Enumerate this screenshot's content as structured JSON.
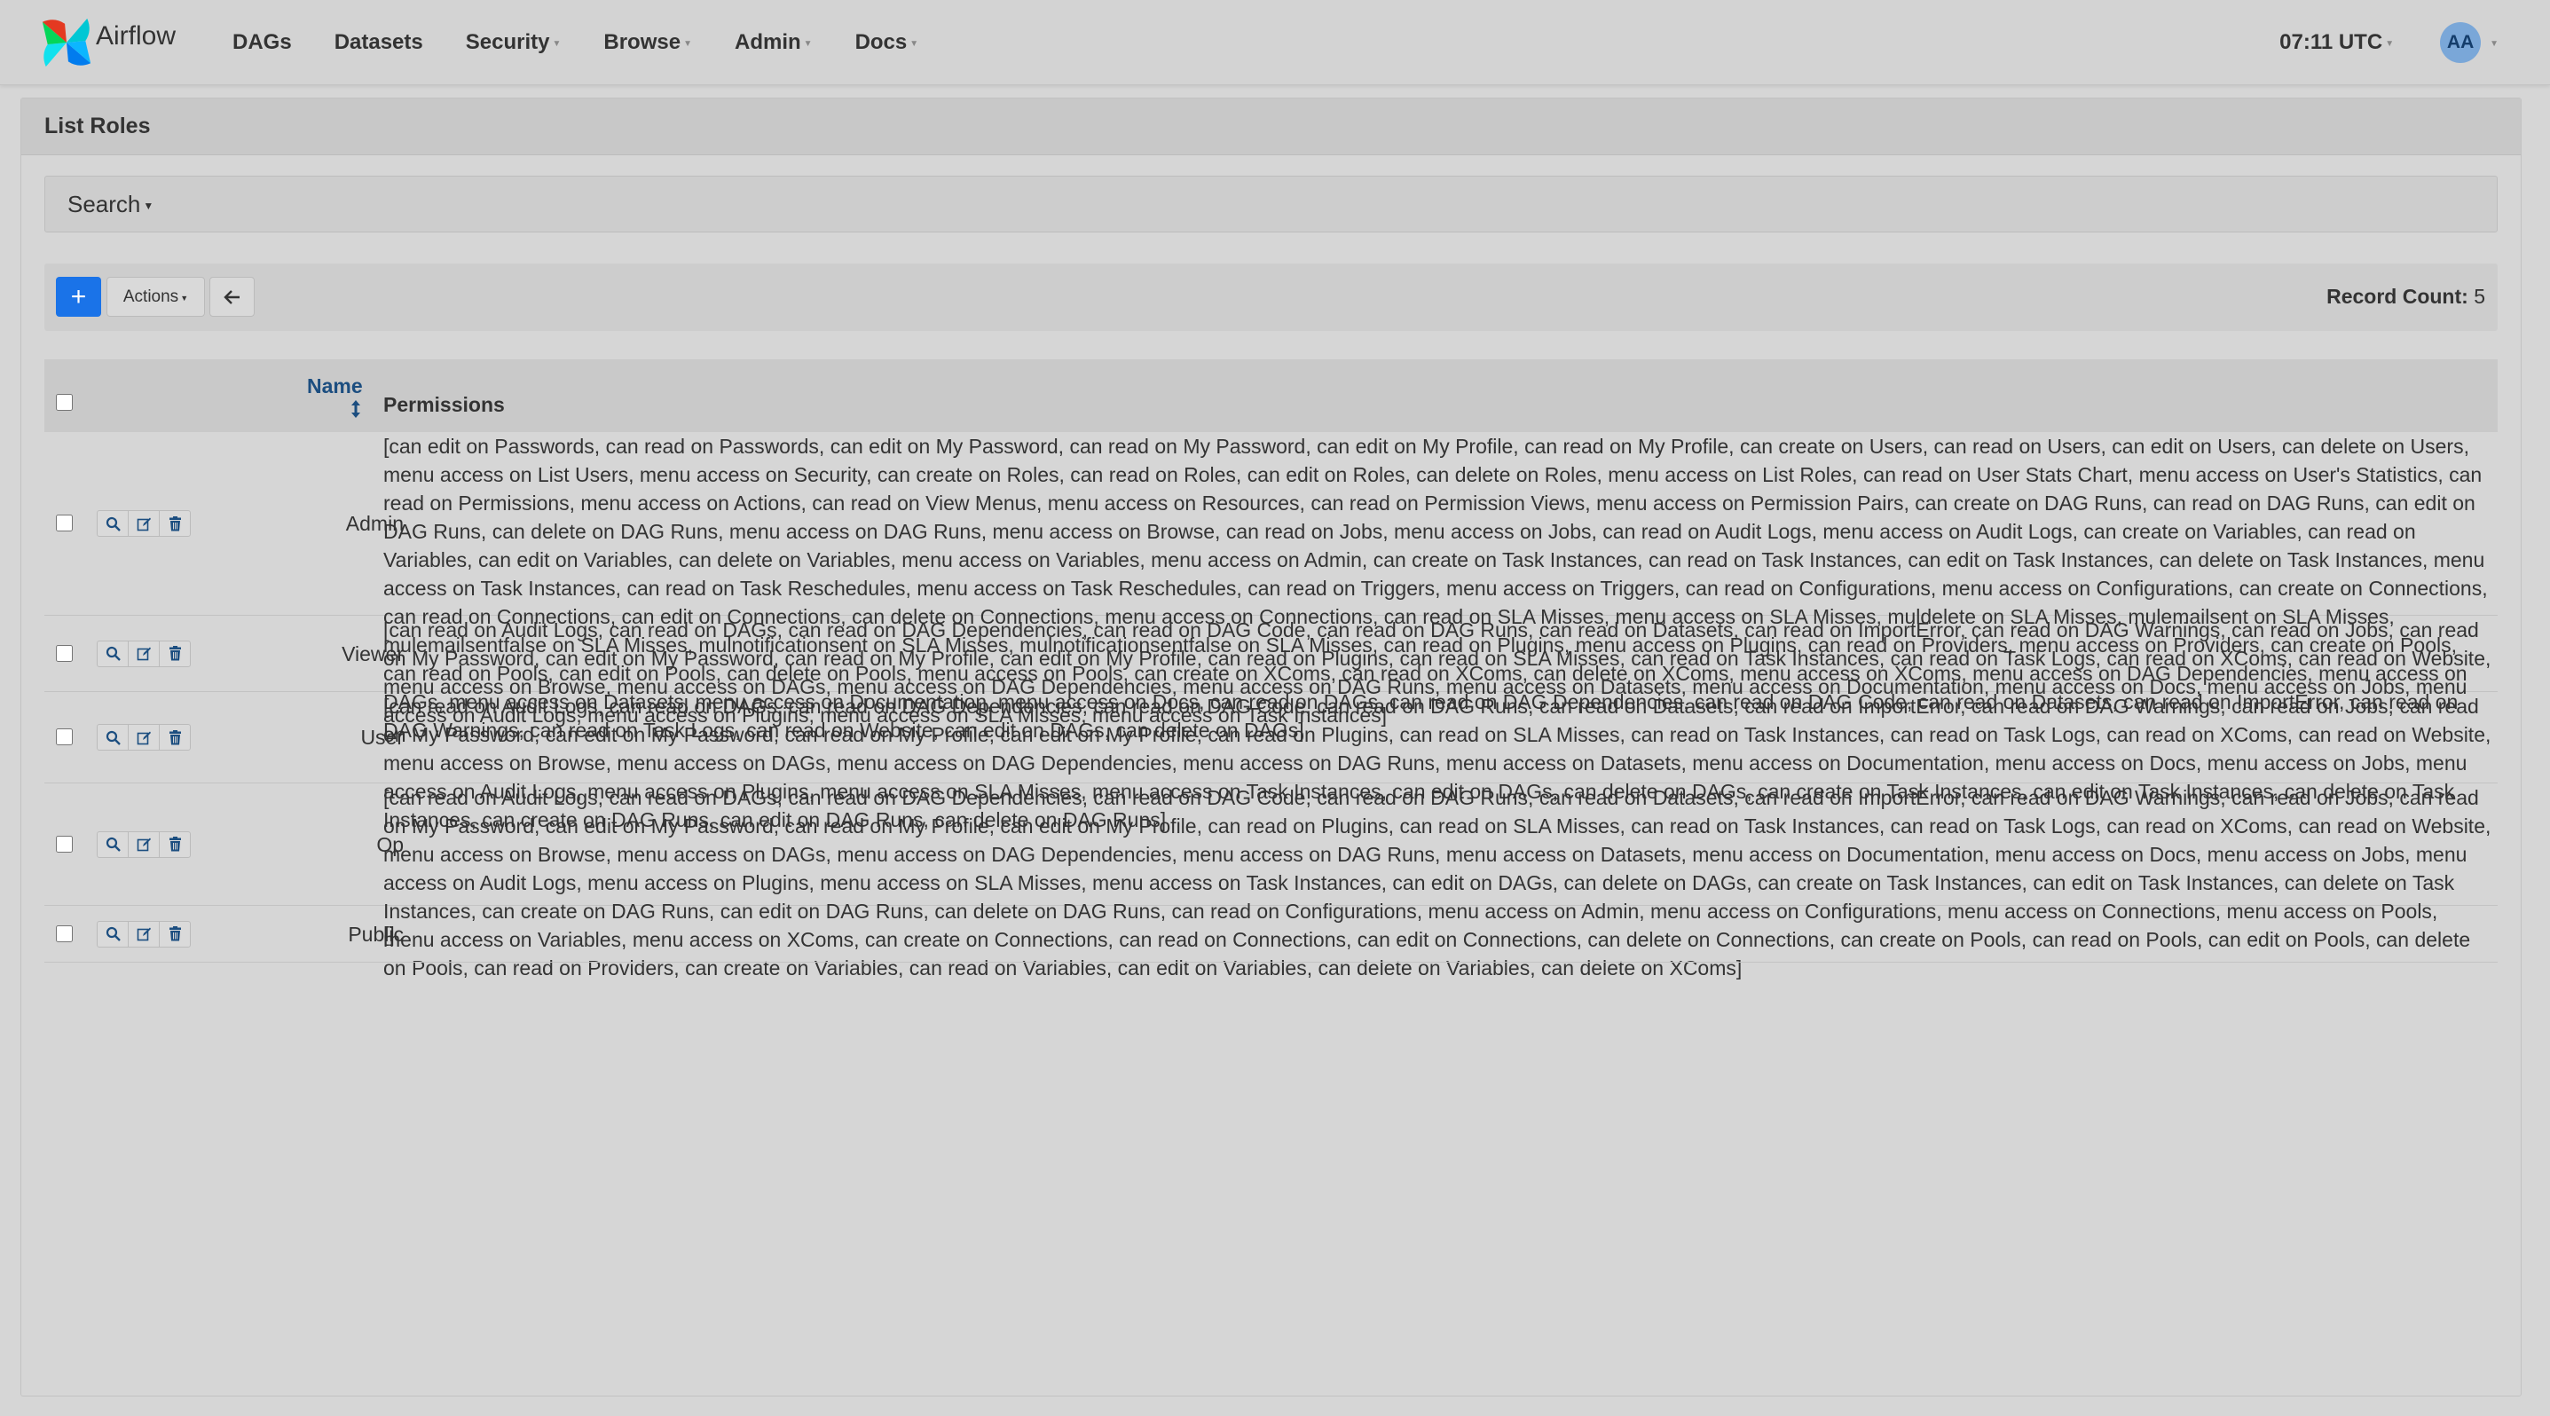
{
  "navbar": {
    "brand": "Airflow",
    "menu": [
      {
        "label": "DAGs",
        "dropdown": false
      },
      {
        "label": "Datasets",
        "dropdown": false
      },
      {
        "label": "Security",
        "dropdown": true
      },
      {
        "label": "Browse",
        "dropdown": true
      },
      {
        "label": "Admin",
        "dropdown": true
      },
      {
        "label": "Docs",
        "dropdown": true
      }
    ],
    "clock": "07:11 UTC",
    "user_initials": "AA"
  },
  "page": {
    "title": "List Roles",
    "search_label": "Search",
    "actions_label": "Actions",
    "record_count_label": "Record Count:",
    "record_count": "5"
  },
  "table": {
    "columns": {
      "name": "Name",
      "permissions": "Permissions"
    },
    "rows": [
      {
        "name": "Admin",
        "permissions": "[can edit on Passwords, can read on Passwords, can edit on My Password, can read on My Password, can edit on My Profile, can read on My Profile, can create on Users, can read on Users, can edit on Users, can delete on Users, menu access on List Users, menu access on Security, can create on Roles, can read on Roles, can edit on Roles, can delete on Roles, menu access on List Roles, can read on User Stats Chart, menu access on User's Statistics, can read on Permissions, menu access on Actions, can read on View Menus, menu access on Resources, can read on Permission Views, menu access on Permission Pairs, can create on DAG Runs, can read on DAG Runs, can edit on DAG Runs, can delete on DAG Runs, menu access on DAG Runs, menu access on Browse, can read on Jobs, menu access on Jobs, can read on Audit Logs, menu access on Audit Logs, can create on Variables, can read on Variables, can edit on Variables, can delete on Variables, menu access on Variables, menu access on Admin, can create on Task Instances, can read on Task Instances, can edit on Task Instances, can delete on Task Instances, menu access on Task Instances, can read on Task Reschedules, menu access on Task Reschedules, can read on Triggers, menu access on Triggers, can read on Configurations, menu access on Configurations, can create on Connections, can read on Connections, can edit on Connections, can delete on Connections, menu access on Connections, can read on SLA Misses, menu access on SLA Misses, muldelete on SLA Misses, mulemailsent on SLA Misses, mulemailsentfalse on SLA Misses, mulnotificationsent on SLA Misses, mulnotificationsentfalse on SLA Misses, can read on Plugins, menu access on Plugins, can read on Providers, menu access on Providers, can create on Pools, can read on Pools, can edit on Pools, can delete on Pools, menu access on Pools, can create on XComs, can read on XComs, can delete on XComs, menu access on XComs, menu access on DAG Dependencies, menu access on DAGs, menu access on Datasets, menu access on Documentation, menu access on Docs, can read on DAGs, can read on DAG Dependencies, can read on DAG Code, can read on Datasets, can read on ImportError, can read on DAG Warnings, can read on Task Logs, can read on Website, can edit on DAGs, can delete on DAGs]"
      },
      {
        "name": "Viewer",
        "permissions": "[can read on Audit Logs, can read on DAGs, can read on DAG Dependencies, can read on DAG Code, can read on DAG Runs, can read on Datasets, can read on ImportError, can read on DAG Warnings, can read on Jobs, can read on My Password, can edit on My Password, can read on My Profile, can edit on My Profile, can read on Plugins, can read on SLA Misses, can read on Task Instances, can read on Task Logs, can read on XComs, can read on Website, menu access on Browse, menu access on DAGs, menu access on DAG Dependencies, menu access on DAG Runs, menu access on Datasets, menu access on Documentation, menu access on Docs, menu access on Jobs, menu access on Audit Logs, menu access on Plugins, menu access on SLA Misses, menu access on Task Instances]"
      },
      {
        "name": "User",
        "permissions": "[can read on Audit Logs, can read on DAGs, can read on DAG Dependencies, can read on DAG Code, can read on DAG Runs, can read on Datasets, can read on ImportError, can read on DAG Warnings, can read on Jobs, can read on My Password, can edit on My Password, can read on My Profile, can edit on My Profile, can read on Plugins, can read on SLA Misses, can read on Task Instances, can read on Task Logs, can read on XComs, can read on Website, menu access on Browse, menu access on DAGs, menu access on DAG Dependencies, menu access on DAG Runs, menu access on Datasets, menu access on Documentation, menu access on Docs, menu access on Jobs, menu access on Audit Logs, menu access on Plugins, menu access on SLA Misses, menu access on Task Instances, can edit on DAGs, can delete on DAGs, can create on Task Instances, can edit on Task Instances, can delete on Task Instances, can create on DAG Runs, can edit on DAG Runs, can delete on DAG Runs]"
      },
      {
        "name": "Op",
        "permissions": "[can read on Audit Logs, can read on DAGs, can read on DAG Dependencies, can read on DAG Code, can read on DAG Runs, can read on Datasets, can read on ImportError, can read on DAG Warnings, can read on Jobs, can read on My Password, can edit on My Password, can read on My Profile, can edit on My Profile, can read on Plugins, can read on SLA Misses, can read on Task Instances, can read on Task Logs, can read on XComs, can read on Website, menu access on Browse, menu access on DAGs, menu access on DAG Dependencies, menu access on DAG Runs, menu access on Datasets, menu access on Documentation, menu access on Docs, menu access on Jobs, menu access on Audit Logs, menu access on Plugins, menu access on SLA Misses, menu access on Task Instances, can edit on DAGs, can delete on DAGs, can create on Task Instances, can edit on Task Instances, can delete on Task Instances, can create on DAG Runs, can edit on DAG Runs, can delete on DAG Runs, can read on Configurations, menu access on Admin, menu access on Configurations, menu access on Connections, menu access on Pools, menu access on Variables, menu access on XComs, can create on Connections, can read on Connections, can edit on Connections, can delete on Connections, can create on Pools, can read on Pools, can edit on Pools, can delete on Pools, can read on Providers, can create on Variables, can read on Variables, can edit on Variables, can delete on Variables, can delete on XComs]"
      },
      {
        "name": "Public",
        "permissions": "[]"
      }
    ]
  }
}
